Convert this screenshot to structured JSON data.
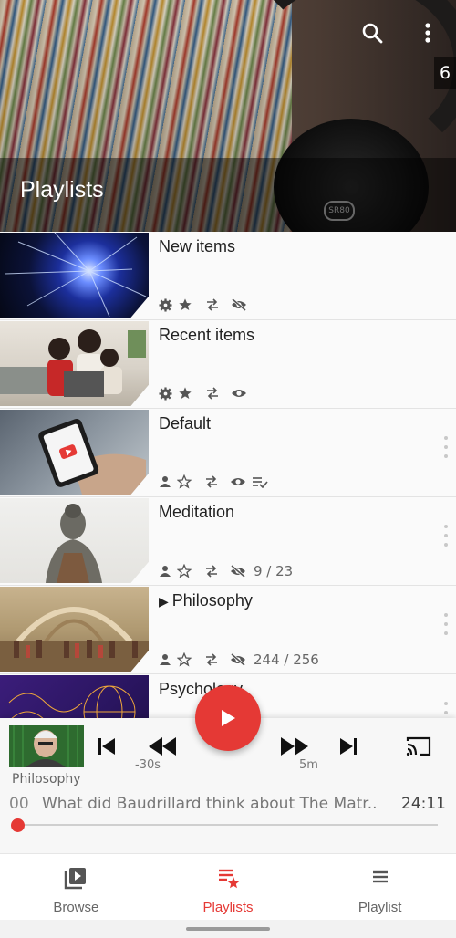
{
  "header": {
    "title": "Playlists",
    "count": "6",
    "search_icon": "search-icon",
    "menu_icon": "more-vert-icon"
  },
  "playlists": [
    {
      "title": "New items",
      "icons": [
        "gear-icon",
        "star-filled-icon",
        "repeat-icon",
        "eye-off-icon"
      ],
      "count": "",
      "more": false,
      "prefix": ""
    },
    {
      "title": "Recent items",
      "icons": [
        "gear-icon",
        "star-filled-icon",
        "repeat-icon",
        "eye-icon"
      ],
      "count": "",
      "more": false,
      "prefix": ""
    },
    {
      "title": "Default",
      "icons": [
        "person-icon",
        "star-outline-icon",
        "repeat-icon",
        "eye-icon",
        "playlist-check-icon"
      ],
      "count": "",
      "more": true,
      "prefix": ""
    },
    {
      "title": "Meditation",
      "icons": [
        "person-icon",
        "star-outline-icon",
        "repeat-icon",
        "eye-off-icon"
      ],
      "count": "9 / 23",
      "more": true,
      "prefix": ""
    },
    {
      "title": "Philosophy",
      "icons": [
        "person-icon",
        "star-outline-icon",
        "repeat-icon",
        "eye-off-icon"
      ],
      "count": "244 / 256",
      "more": true,
      "prefix": "▶"
    },
    {
      "title": "Psychology",
      "icons": [],
      "count": "",
      "more": true,
      "prefix": ""
    }
  ],
  "player": {
    "playlist": "Philosophy",
    "rewind_label": "-30s",
    "forward_label": "5m",
    "time_start": "00",
    "title": "What did Baudrillard think about The Matr..",
    "duration": "24:11",
    "progress": 0.0
  },
  "nav": {
    "browse": "Browse",
    "playlists": "Playlists",
    "playlist": "Playlist"
  },
  "colors": {
    "accent": "#e53935"
  }
}
